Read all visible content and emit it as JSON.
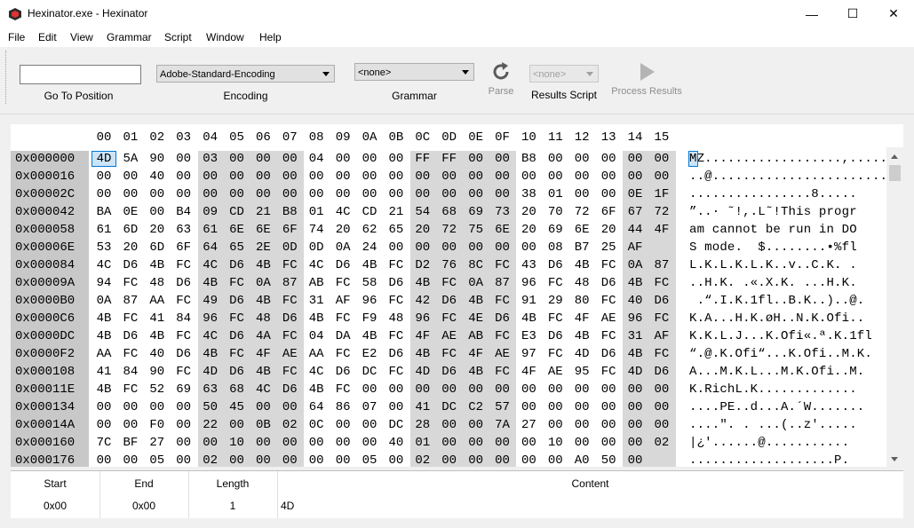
{
  "window": {
    "title": "Hexinator.exe - Hexinator",
    "minimize": "—",
    "maximize": "☐",
    "close": "✕"
  },
  "menu": [
    "File",
    "Edit",
    "View",
    "Grammar",
    "Script",
    "Window",
    "Help"
  ],
  "toolbar": {
    "goto_label": "Go To Position",
    "goto_value": "",
    "encoding_value": "Adobe-Standard-Encoding",
    "encoding_label": "Encoding",
    "grammar_value": "<none>",
    "grammar_label": "Grammar",
    "parse_label": "Parse",
    "results_script_value": "<none>",
    "results_script_label": "Results Script",
    "process_results_label": "Process Results"
  },
  "hex": {
    "columns": [
      "00",
      "01",
      "02",
      "03",
      "04",
      "05",
      "06",
      "07",
      "08",
      "09",
      "0A",
      "0B",
      "0C",
      "0D",
      "0E",
      "0F",
      "10",
      "11",
      "12",
      "13",
      "14",
      "15"
    ],
    "rows": [
      {
        "offset": "0x000000",
        "bytes": [
          "4D",
          "5A",
          "90",
          "00",
          "03",
          "00",
          "00",
          "00",
          "04",
          "00",
          "00",
          "00",
          "FF",
          "FF",
          "00",
          "00",
          "B8",
          "00",
          "00",
          "00",
          "00",
          "00"
        ],
        "ascii": "MZ..................,....."
      },
      {
        "offset": "0x000016",
        "bytes": [
          "00",
          "00",
          "40",
          "00",
          "00",
          "00",
          "00",
          "00",
          "00",
          "00",
          "00",
          "00",
          "00",
          "00",
          "00",
          "00",
          "00",
          "00",
          "00",
          "00",
          "00",
          "00"
        ],
        "ascii": "..@......................."
      },
      {
        "offset": "0x00002C",
        "bytes": [
          "00",
          "00",
          "00",
          "00",
          "00",
          "00",
          "00",
          "00",
          "00",
          "00",
          "00",
          "00",
          "00",
          "00",
          "00",
          "00",
          "38",
          "01",
          "00",
          "00",
          "0E",
          "1F"
        ],
        "ascii": "................8....."
      },
      {
        "offset": "0x000042",
        "bytes": [
          "BA",
          "0E",
          "00",
          "B4",
          "09",
          "CD",
          "21",
          "B8",
          "01",
          "4C",
          "CD",
          "21",
          "54",
          "68",
          "69",
          "73",
          "20",
          "70",
          "72",
          "6F",
          "67",
          "72"
        ],
        "ascii": "”..· ˜!,.L˜!This progr"
      },
      {
        "offset": "0x000058",
        "bytes": [
          "61",
          "6D",
          "20",
          "63",
          "61",
          "6E",
          "6E",
          "6F",
          "74",
          "20",
          "62",
          "65",
          "20",
          "72",
          "75",
          "6E",
          "20",
          "69",
          "6E",
          "20",
          "44",
          "4F"
        ],
        "ascii": "am cannot be run in DO"
      },
      {
        "offset": "0x00006E",
        "bytes": [
          "53",
          "20",
          "6D",
          "6F",
          "64",
          "65",
          "2E",
          "0D",
          "0D",
          "0A",
          "24",
          "00",
          "00",
          "00",
          "00",
          "00",
          "00",
          "08",
          "B7",
          "25",
          "AF"
        ],
        "ascii": "S mode.  $........•%fl"
      },
      {
        "offset": "0x000084",
        "bytes": [
          "4C",
          "D6",
          "4B",
          "FC",
          "4C",
          "D6",
          "4B",
          "FC",
          "4C",
          "D6",
          "4B",
          "FC",
          "D2",
          "76",
          "8C",
          "FC",
          "43",
          "D6",
          "4B",
          "FC",
          "0A",
          "87"
        ],
        "ascii": "L.K.L.K.L.K..v..C.K. ."
      },
      {
        "offset": "0x00009A",
        "bytes": [
          "94",
          "FC",
          "48",
          "D6",
          "4B",
          "FC",
          "0A",
          "87",
          "AB",
          "FC",
          "58",
          "D6",
          "4B",
          "FC",
          "0A",
          "87",
          "96",
          "FC",
          "48",
          "D6",
          "4B",
          "FC"
        ],
        "ascii": "..H.K. .«.X.K. ...H.K."
      },
      {
        "offset": "0x0000B0",
        "bytes": [
          "0A",
          "87",
          "AA",
          "FC",
          "49",
          "D6",
          "4B",
          "FC",
          "31",
          "AF",
          "96",
          "FC",
          "42",
          "D6",
          "4B",
          "FC",
          "91",
          "29",
          "80",
          "FC",
          "40",
          "D6"
        ],
        "ascii": " .“.I.K.1fl..B.K..)..@."
      },
      {
        "offset": "0x0000C6",
        "bytes": [
          "4B",
          "FC",
          "41",
          "84",
          "96",
          "FC",
          "48",
          "D6",
          "4B",
          "FC",
          "F9",
          "48",
          "96",
          "FC",
          "4E",
          "D6",
          "4B",
          "FC",
          "4F",
          "AE",
          "96",
          "FC"
        ],
        "ascii": "K.A...H.K.øH..N.K.Ofi.."
      },
      {
        "offset": "0x0000DC",
        "bytes": [
          "4B",
          "D6",
          "4B",
          "FC",
          "4C",
          "D6",
          "4A",
          "FC",
          "04",
          "DA",
          "4B",
          "FC",
          "4F",
          "AE",
          "AB",
          "FC",
          "E3",
          "D6",
          "4B",
          "FC",
          "31",
          "AF"
        ],
        "ascii": "K.K.L.J...K.Ofi«.ª.K.1fl"
      },
      {
        "offset": "0x0000F2",
        "bytes": [
          "AA",
          "FC",
          "40",
          "D6",
          "4B",
          "FC",
          "4F",
          "AE",
          "AA",
          "FC",
          "E2",
          "D6",
          "4B",
          "FC",
          "4F",
          "AE",
          "97",
          "FC",
          "4D",
          "D6",
          "4B",
          "FC"
        ],
        "ascii": "“.@.K.Ofi“...K.Ofi..M.K."
      },
      {
        "offset": "0x000108",
        "bytes": [
          "41",
          "84",
          "90",
          "FC",
          "4D",
          "D6",
          "4B",
          "FC",
          "4C",
          "D6",
          "DC",
          "FC",
          "4D",
          "D6",
          "4B",
          "FC",
          "4F",
          "AE",
          "95",
          "FC",
          "4D",
          "D6"
        ],
        "ascii": "A...M.K.L...M.K.Ofi..M."
      },
      {
        "offset": "0x00011E",
        "bytes": [
          "4B",
          "FC",
          "52",
          "69",
          "63",
          "68",
          "4C",
          "D6",
          "4B",
          "FC",
          "00",
          "00",
          "00",
          "00",
          "00",
          "00",
          "00",
          "00",
          "00",
          "00",
          "00",
          "00"
        ],
        "ascii": "K.RichL.K............."
      },
      {
        "offset": "0x000134",
        "bytes": [
          "00",
          "00",
          "00",
          "00",
          "50",
          "45",
          "00",
          "00",
          "64",
          "86",
          "07",
          "00",
          "41",
          "DC",
          "C2",
          "57",
          "00",
          "00",
          "00",
          "00",
          "00",
          "00"
        ],
        "ascii": "....PE..d...A.´W......."
      },
      {
        "offset": "0x00014A",
        "bytes": [
          "00",
          "00",
          "F0",
          "00",
          "22",
          "00",
          "0B",
          "02",
          "0C",
          "00",
          "00",
          "DC",
          "28",
          "00",
          "00",
          "7A",
          "27",
          "00",
          "00",
          "00",
          "00",
          "00"
        ],
        "ascii": "....\". . ...(..z'....."
      },
      {
        "offset": "0x000160",
        "bytes": [
          "7C",
          "BF",
          "27",
          "00",
          "00",
          "10",
          "00",
          "00",
          "00",
          "00",
          "00",
          "40",
          "01",
          "00",
          "00",
          "00",
          "00",
          "10",
          "00",
          "00",
          "00",
          "02"
        ],
        "ascii": "|¿'......@..........."
      },
      {
        "offset": "0x000176",
        "bytes": [
          "00",
          "00",
          "05",
          "00",
          "02",
          "00",
          "00",
          "00",
          "00",
          "00",
          "05",
          "00",
          "02",
          "00",
          "00",
          "00",
          "00",
          "00",
          "A0",
          "50",
          "00"
        ],
        "ascii": "...................P."
      }
    ]
  },
  "results": {
    "headers": [
      "Start",
      "End",
      "Length",
      "Content"
    ],
    "values": [
      "0x00",
      "0x00",
      "1",
      "4D"
    ]
  }
}
